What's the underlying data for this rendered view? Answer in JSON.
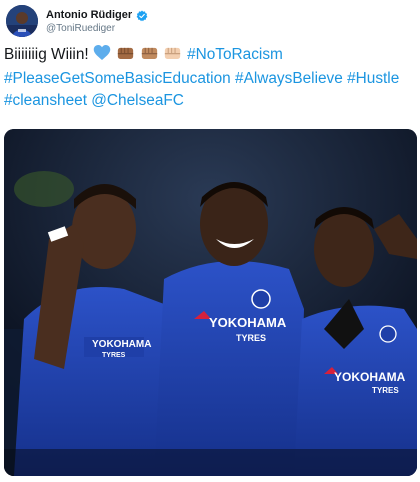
{
  "author": {
    "display_name": "Antonio Rüdiger",
    "handle": "@ToniRuediger",
    "verified_icon": "verified-badge-icon"
  },
  "tweet": {
    "word": "Biiiiiiig Wiiin!",
    "emojis": [
      "blue-heart-icon",
      "fist-medium-dark-icon",
      "fist-medium-icon",
      "fist-light-icon"
    ],
    "hashtags": {
      "h1": "#NoToRacism",
      "h2": "#PleaseGetSomeBasicEducation",
      "h3": "#AlwaysBelieve",
      "h4": "#Hustle",
      "h5": "#cleansheet"
    },
    "mention": "@ChelseaFC"
  },
  "media": {
    "kit_sponsor": "YOKOHAMA",
    "kit_sponsor_sub": "TYRES",
    "description_icon": "team-celebration-photo"
  },
  "colors": {
    "link": "#1b95e0",
    "verified": "#1da1f2",
    "kit_blue": "#1f3fa8"
  }
}
